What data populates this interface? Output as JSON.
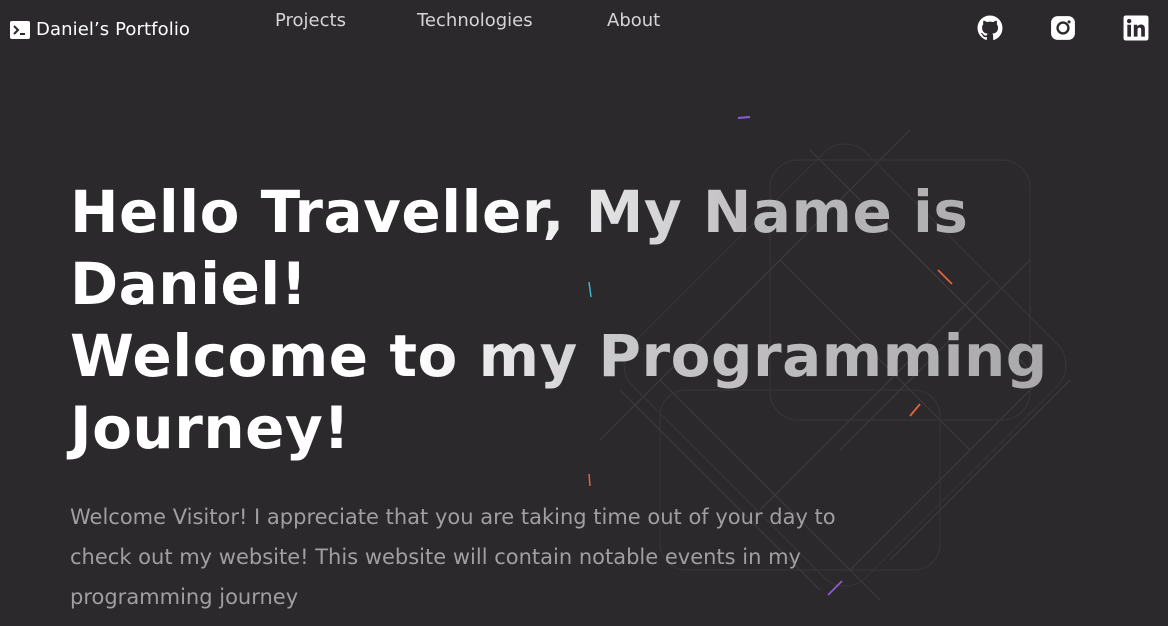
{
  "nav": {
    "brand": "Daniel’s Portfolio",
    "links": [
      "Projects",
      "Technologies",
      "About"
    ],
    "social": [
      {
        "name": "github",
        "icon": "github-icon"
      },
      {
        "name": "instagram",
        "icon": "instagram-icon"
      },
      {
        "name": "linkedin",
        "icon": "linkedin-icon"
      }
    ]
  },
  "hero": {
    "title_line1": "Hello Traveller, My Name is",
    "title_line2": "Daniel!",
    "title_line3": "Welcome to my Programming",
    "title_line4": "Journey!",
    "text": "Welcome Visitor! I appreciate that you are taking time out of your day to check out my website! This website will contain notable events in my programming journey"
  },
  "colors": {
    "background": "#2b292c",
    "text_primary": "#ffffff",
    "text_muted": "#a09ea2",
    "nav_link": "#d6d4d7"
  }
}
